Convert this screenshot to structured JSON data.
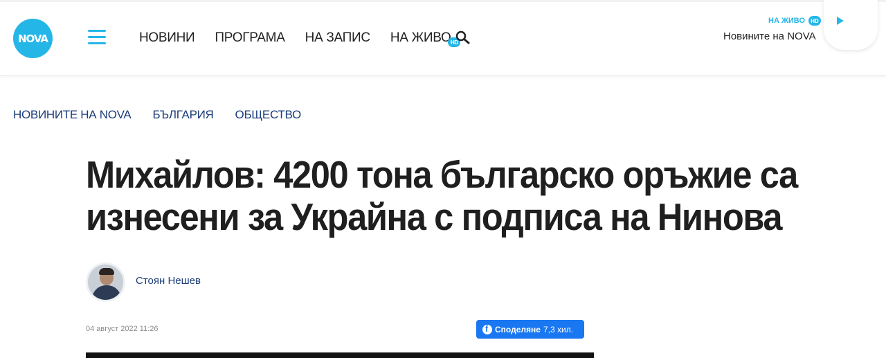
{
  "header": {
    "logo_text": "NOVA",
    "nav": [
      {
        "label": "НОВИНИ"
      },
      {
        "label": "ПРОГРАМА"
      },
      {
        "label": "НА ЗАПИС"
      },
      {
        "label": "НА ЖИВО",
        "badge": "HD"
      }
    ],
    "live": {
      "label": "НА ЖИВО",
      "badge": "HD",
      "title": "Новините на NOVA"
    }
  },
  "breadcrumb": [
    "НОВИНИТЕ НА NOVA",
    "БЪЛГАРИЯ",
    "ОБЩЕСТВО"
  ],
  "article": {
    "headline": "Михайлов: 4200 тона българско оръжие са изнесени за Украйна с подписа на Нинова",
    "author": "Стоян Нешев",
    "date": "04 август 2022 11:26",
    "share": {
      "label": "Споделяне",
      "count": "7,3 хил."
    }
  },
  "icons": {
    "menu": "hamburger-menu-icon",
    "search": "search-icon",
    "play": "play-icon",
    "share": "facebook-icon"
  },
  "colors": {
    "brand": "#25b6e8",
    "link": "#1b3d7a",
    "facebook": "#1a77f2"
  }
}
